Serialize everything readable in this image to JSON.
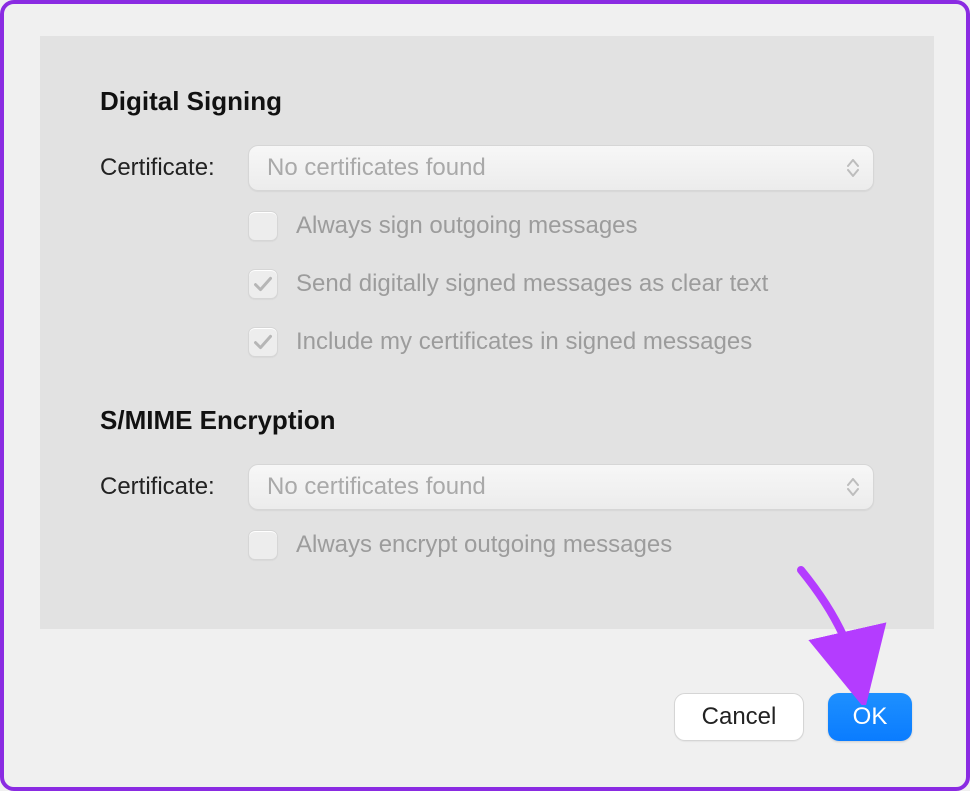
{
  "digital_signing": {
    "title": "Digital Signing",
    "certificate_label": "Certificate:",
    "certificate_placeholder": "No certificates found",
    "options": {
      "always_sign": {
        "label": "Always sign outgoing messages",
        "checked": false
      },
      "clear_text": {
        "label": "Send digitally signed messages as clear text",
        "checked": true
      },
      "include_cert": {
        "label": "Include my certificates in signed messages",
        "checked": true
      }
    }
  },
  "smime_encryption": {
    "title": "S/MIME Encryption",
    "certificate_label": "Certificate:",
    "certificate_placeholder": "No certificates found",
    "options": {
      "always_encrypt": {
        "label": "Always encrypt outgoing messages",
        "checked": false
      }
    }
  },
  "buttons": {
    "cancel": "Cancel",
    "ok": "OK"
  }
}
